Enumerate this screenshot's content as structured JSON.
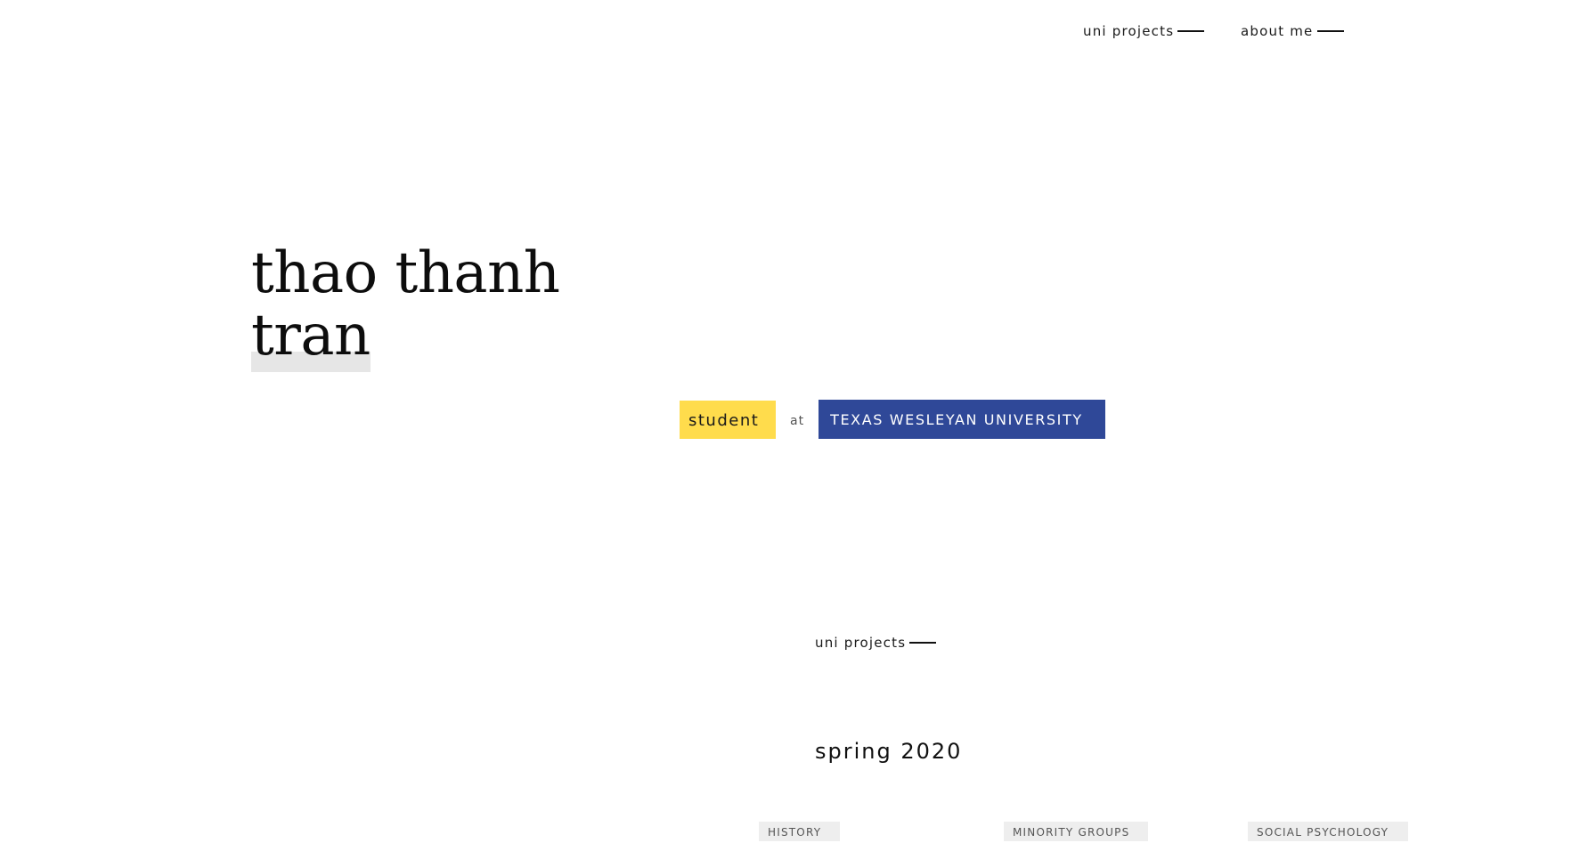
{
  "nav": {
    "items": [
      {
        "label": "uni projects"
      },
      {
        "label": "about me"
      }
    ]
  },
  "hero": {
    "name_line1": "thao thanh",
    "name_line2": "tran",
    "role": "student",
    "at": "at",
    "institution": "TEXAS WESLEYAN UNIVERSITY"
  },
  "colors": {
    "role_badge": "#ffdc4c",
    "institution_badge": "#2f4898",
    "name_highlight": "#e6e6e6",
    "tag_background": "#eeeeee"
  },
  "section": {
    "label": "uni projects",
    "term": "spring 2020",
    "tags": [
      "HISTORY",
      "MINORITY GROUPS",
      "SOCIAL PSYCHOLOGY"
    ]
  }
}
